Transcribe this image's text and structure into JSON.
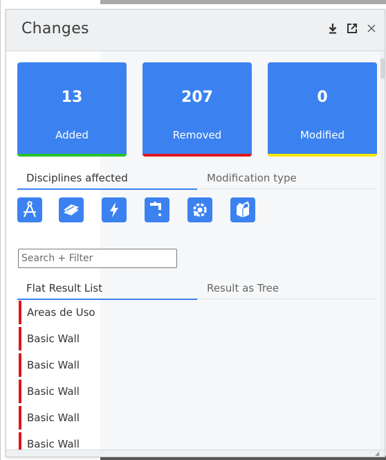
{
  "panel": {
    "title": "Changes",
    "header_icons": [
      "download-icon",
      "popout-icon",
      "close-icon"
    ]
  },
  "summary": {
    "cards": [
      {
        "count": "13",
        "label": "Added",
        "color": "#26c32a"
      },
      {
        "count": "207",
        "label": "Removed",
        "color": "#e0161c"
      },
      {
        "count": "0",
        "label": "Modified",
        "color": "#f7e600"
      }
    ]
  },
  "tabs": {
    "items": [
      {
        "label": "Disciplines affected",
        "active": true
      },
      {
        "label": "Modification type",
        "active": false
      }
    ]
  },
  "disciplines": {
    "icons": [
      "architecture-icon",
      "structure-icon",
      "electrical-icon",
      "plumbing-icon",
      "mechanical-icon",
      "other-icon"
    ]
  },
  "search": {
    "placeholder": "Search + Filter",
    "value": ""
  },
  "result_tabs": {
    "items": [
      {
        "label": "Flat Result List",
        "active": true
      },
      {
        "label": "Result as Tree",
        "active": false
      }
    ]
  },
  "results": {
    "items": [
      {
        "label": "Areas de Uso",
        "status_color": "#e0161c"
      },
      {
        "label": "Basic Wall",
        "status_color": "#e0161c"
      },
      {
        "label": "Basic Wall",
        "status_color": "#e0161c"
      },
      {
        "label": "Basic Wall",
        "status_color": "#e0161c"
      },
      {
        "label": "Basic Wall",
        "status_color": "#e0161c"
      },
      {
        "label": "Basic Wall",
        "status_color": "#e0161c"
      }
    ]
  },
  "colors": {
    "accent": "#3b82f0",
    "added": "#26c32a",
    "removed": "#e0161c",
    "modified": "#f7e600"
  }
}
